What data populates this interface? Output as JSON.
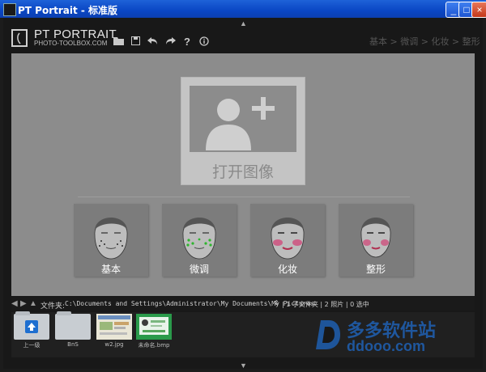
{
  "window": {
    "title": "PT Portrait - 标准版",
    "buttons": {
      "minimize": "_",
      "maximize": "□",
      "close": "×"
    }
  },
  "header": {
    "logo_title": "PT PORTRAIT",
    "logo_subtitle": "PHOTO-TOOLBOX.COM",
    "toolbar_icons": [
      "folder-open-icon",
      "save-icon",
      "undo-icon",
      "redo-icon",
      "help-icon",
      "info-icon"
    ],
    "breadcrumb": "基本 > 微调 > 化妆 > 整形"
  },
  "main": {
    "open_image_label": "打开图像",
    "modes": [
      {
        "label": "基本"
      },
      {
        "label": "微调"
      },
      {
        "label": "化妆"
      },
      {
        "label": "整形"
      }
    ]
  },
  "pathbar": {
    "label": "文件夹:",
    "path": "C:\\Documents and Settings\\Administrator\\My Documents\\My Pictures",
    "stats": "| 1 子文件夹 | 2 照片 | 0 选中"
  },
  "files": [
    {
      "name": "上一级",
      "kind": "up-folder"
    },
    {
      "name": "BnS",
      "kind": "folder"
    },
    {
      "name": "w2.jpg",
      "kind": "image"
    },
    {
      "name": "未命名.bmp",
      "kind": "image"
    }
  ],
  "watermark": {
    "text": "多多软件站",
    "url": "ddooo.com"
  },
  "colors": {
    "titlebar": "#0a46c4",
    "panel": "#8c8c8c",
    "card": "#c4c4c4",
    "watermark": "#1f5fb0"
  }
}
